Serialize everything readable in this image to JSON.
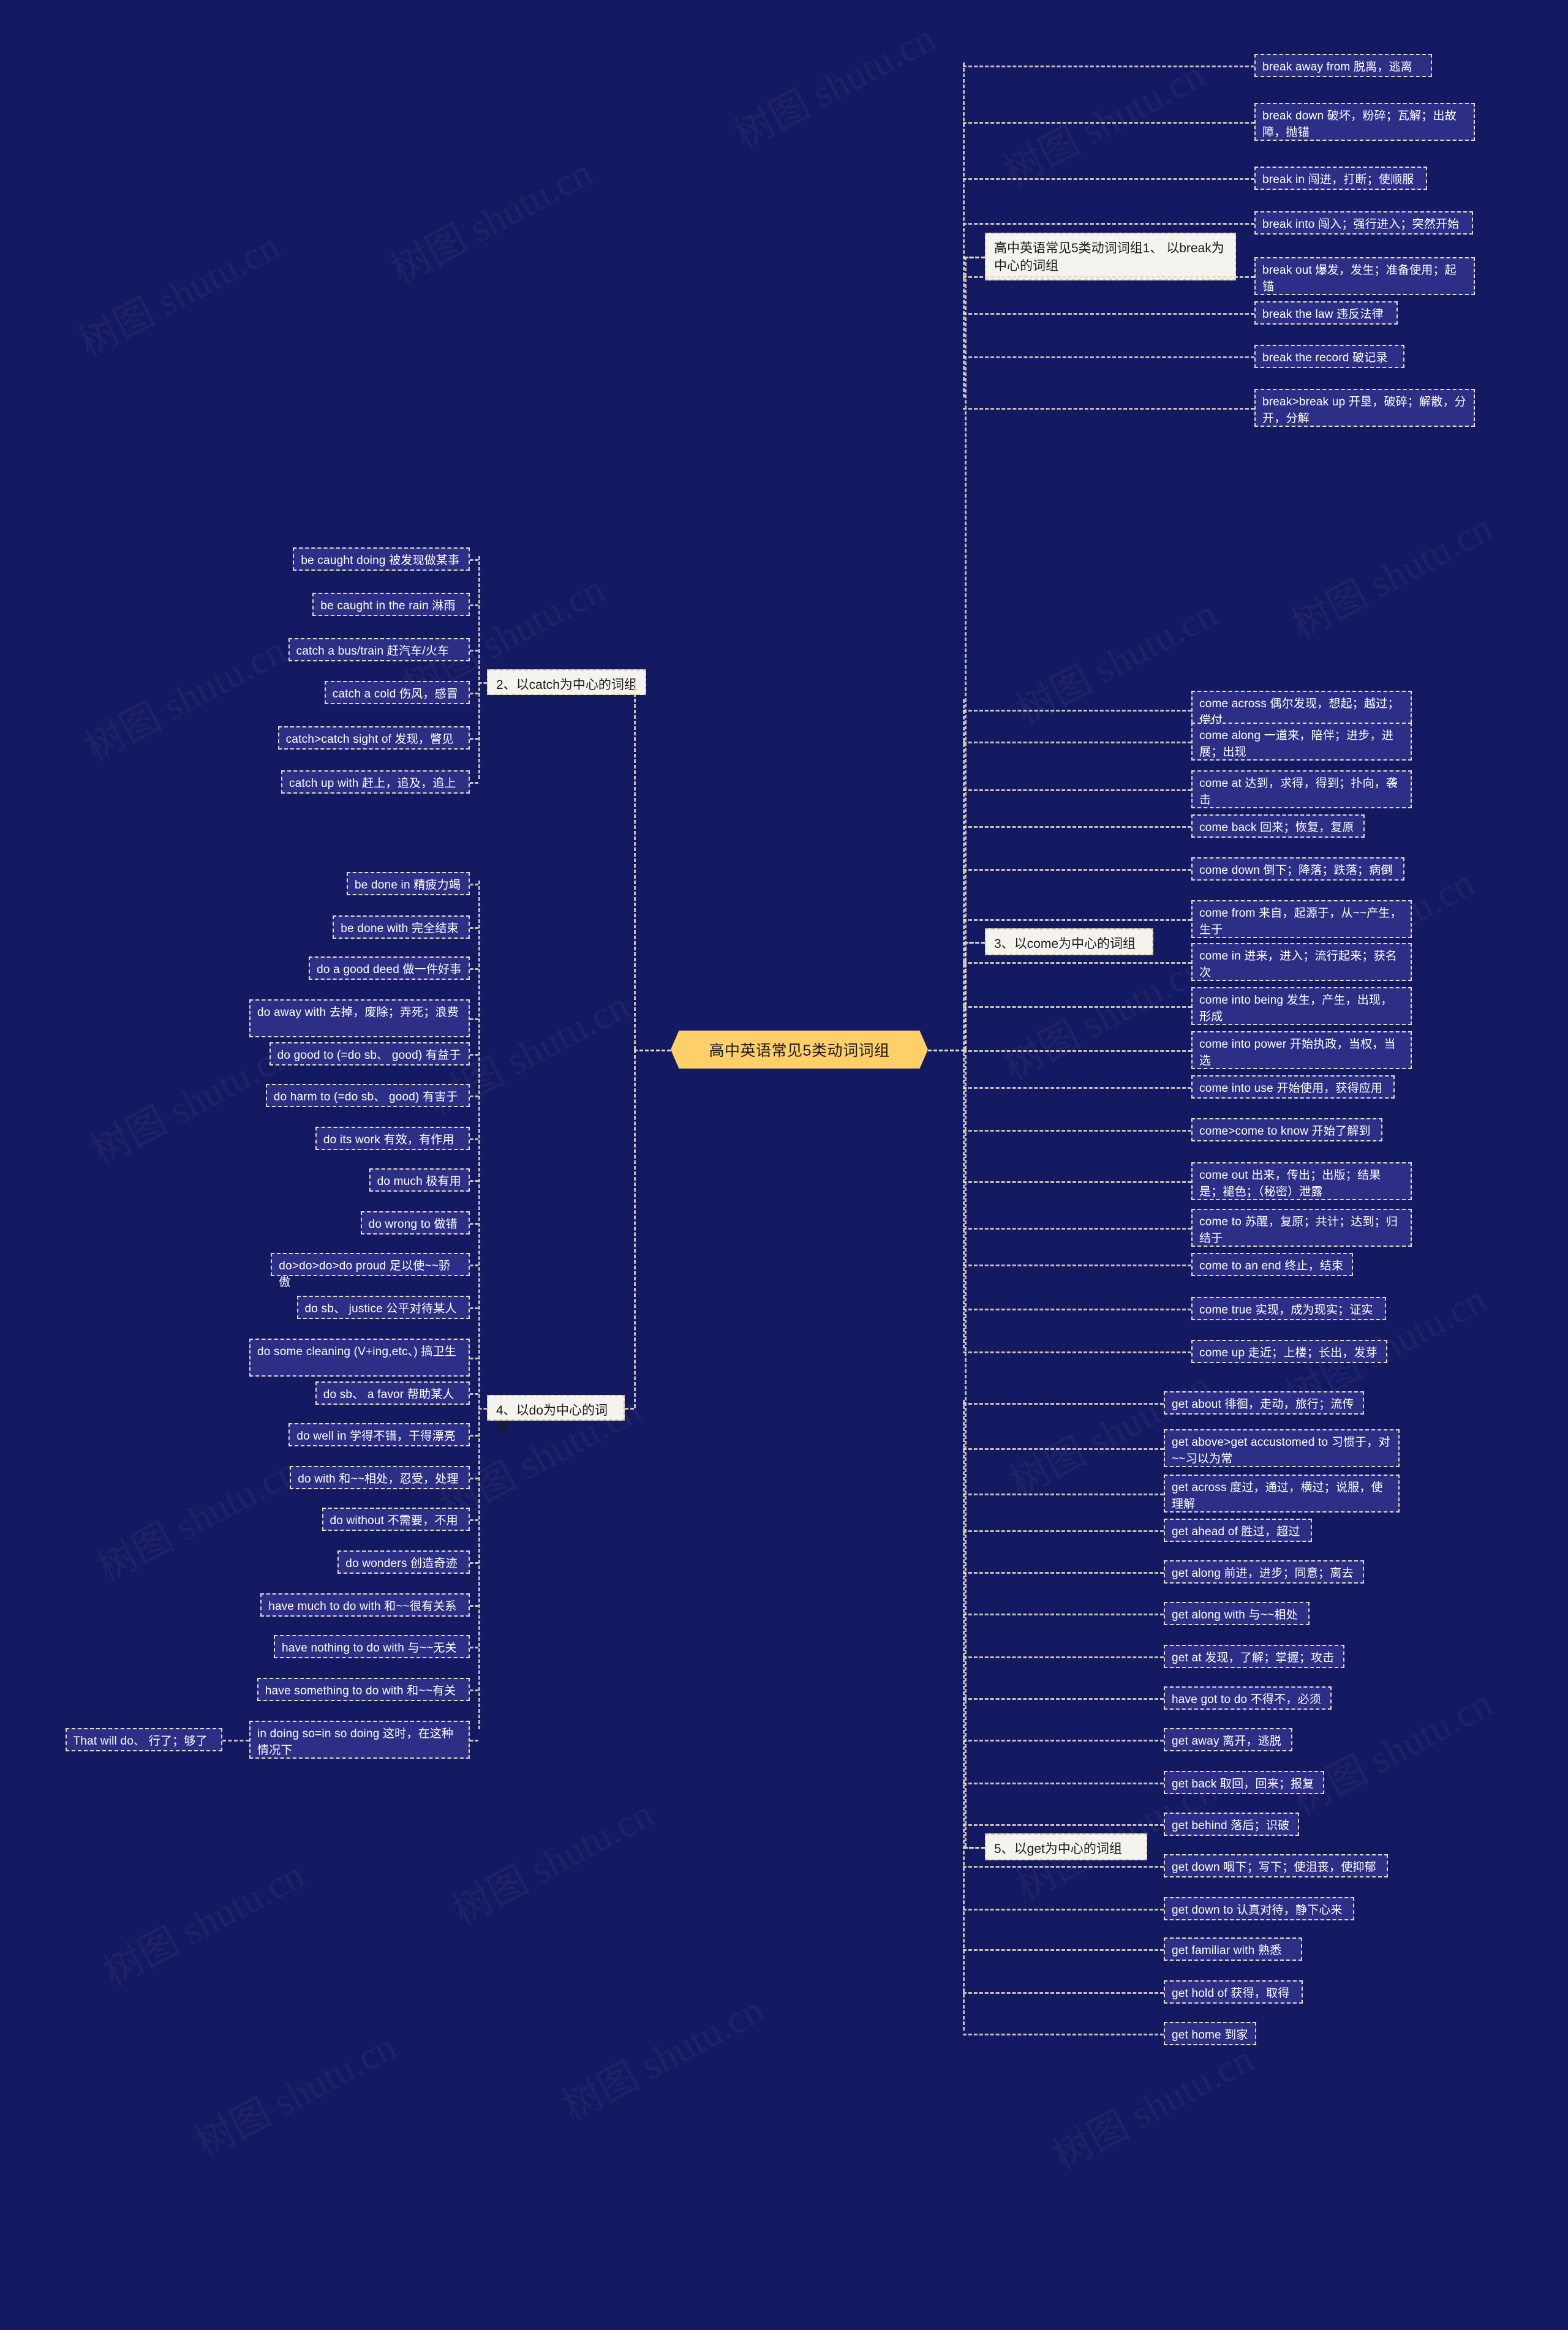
{
  "root": {
    "label": "高中英语常见5类动词词组"
  },
  "colors": {
    "background": "#141a62",
    "node_fill": "#2d2f86",
    "node_border": "#e6dcc2",
    "branch_fill": "#f4f3ee",
    "root_fill": "#ffcf68",
    "connector": "#e8dcc0",
    "node_text": "#ffffff",
    "branch_text": "#1b1b1b"
  },
  "watermark": {
    "text": "树图 shutu.cn"
  },
  "branches": [
    {
      "id": "break",
      "label": "高中英语常见5类动词词组1、 以break为中心的词组",
      "side": "right",
      "items": [
        {
          "text": "break away from 脱离，逃离"
        },
        {
          "text": "break down 破坏，粉碎；瓦解；出故障，抛锚"
        },
        {
          "text": "break in 闯进，打断；使顺服"
        },
        {
          "text": "break into 闯入；强行进入；突然开始"
        },
        {
          "text": "break out 爆发，发生；准备使用；起锚"
        },
        {
          "text": "break the law 违反法律"
        },
        {
          "text": "break the record 破记录"
        },
        {
          "text": "break>break up 开垦，破碎；解散，分开，分解"
        }
      ]
    },
    {
      "id": "catch",
      "label": "2、以catch为中心的词组",
      "side": "left",
      "items": [
        {
          "text": "be caught doing 被发现做某事"
        },
        {
          "text": "be caught in the rain 淋雨"
        },
        {
          "text": "catch a bus/train 赶汽车/火车"
        },
        {
          "text": "catch a cold 伤风，感冒"
        },
        {
          "text": "catch>catch sight of 发现，瞥见"
        },
        {
          "text": "catch up with 赶上，追及，追上"
        }
      ]
    },
    {
      "id": "come",
      "label": "3、以come为中心的词组",
      "side": "right",
      "items": [
        {
          "text": "come across 偶尔发现，想起；越过；偿付"
        },
        {
          "text": "come along 一道来，陪伴；进步，进展；出现"
        },
        {
          "text": "come at 达到，求得，得到；扑向，袭击"
        },
        {
          "text": "come back 回来；恢复，复原"
        },
        {
          "text": "come down 倒下；降落；跌落；病倒"
        },
        {
          "text": "come from 来自，起源于，从~~产生，生于"
        },
        {
          "text": "come in 进来，进入；流行起来；获名次"
        },
        {
          "text": "come into being 发生，产生，出现，形成"
        },
        {
          "text": "come into power 开始执政，当权，当选"
        },
        {
          "text": "come into use 开始使用，获得应用"
        },
        {
          "text": "come>come to know 开始了解到"
        },
        {
          "text": "come out 出来，传出；出版；结果是；褪色；（秘密）泄露"
        },
        {
          "text": "come to 苏醒，复原；共计；达到；归结于"
        },
        {
          "text": "come to an end 终止，结束"
        },
        {
          "text": "come true 实现，成为现实；证实"
        },
        {
          "text": "come up 走近；上楼；长出，发芽"
        }
      ]
    },
    {
      "id": "do",
      "label": "4、以do为中心的词组",
      "side": "left",
      "items": [
        {
          "text": "be done in 精疲力竭"
        },
        {
          "text": "be done with 完全结束"
        },
        {
          "text": "do a good deed 做一件好事"
        },
        {
          "text": "do away with 去掉，废除；弄死；浪费"
        },
        {
          "text": "do good to (=do sb、 good) 有益于"
        },
        {
          "text": "do harm to (=do sb、 good) 有害于"
        },
        {
          "text": "do its work 有效，有作用"
        },
        {
          "text": "do much 极有用"
        },
        {
          "text": "do wrong to 做错"
        },
        {
          "text": "do>do>do>do proud 足以使~~骄傲"
        },
        {
          "text": "do sb、 justice 公平对待某人"
        },
        {
          "text": "do some cleaning (V+ing,etc、) 搞卫生"
        },
        {
          "text": "do sb、 a favor 帮助某人"
        },
        {
          "text": "do well in 学得不错，干得漂亮"
        },
        {
          "text": "do with 和~~相处，忍受，处理"
        },
        {
          "text": "do without 不需要，不用"
        },
        {
          "text": "do wonders 创造奇迹"
        },
        {
          "text": "have much to do with 和~~很有关系"
        },
        {
          "text": "have nothing to do with 与~~无关"
        },
        {
          "text": "have something to do with 和~~有关"
        },
        {
          "text": "in doing so=in so doing 这时，在这种情况下",
          "child": "That will do、 行了；够了"
        }
      ]
    },
    {
      "id": "get",
      "label": "5、以get为中心的词组",
      "side": "right",
      "items": [
        {
          "text": "get about 徘徊，走动，旅行；流传"
        },
        {
          "text": "get above>get accustomed to 习惯于，对~~习以为常"
        },
        {
          "text": "get across 度过，通过，横过；说服，使理解"
        },
        {
          "text": "get ahead of 胜过，超过"
        },
        {
          "text": "get along 前进，进步；同意；离去"
        },
        {
          "text": "get along with 与~~相处"
        },
        {
          "text": "get at 发现，了解；掌握；攻击"
        },
        {
          "text": "have got to do 不得不，必须"
        },
        {
          "text": "get away 离开，逃脱"
        },
        {
          "text": "get back 取回，回来；报复"
        },
        {
          "text": "get behind 落后；识破"
        },
        {
          "text": "get down 咽下；写下；使沮丧，使抑郁"
        },
        {
          "text": "get down to 认真对待，静下心来"
        },
        {
          "text": "get familiar with 熟悉"
        },
        {
          "text": "get hold of 获得，取得"
        },
        {
          "text": "get home 到家"
        }
      ]
    }
  ]
}
